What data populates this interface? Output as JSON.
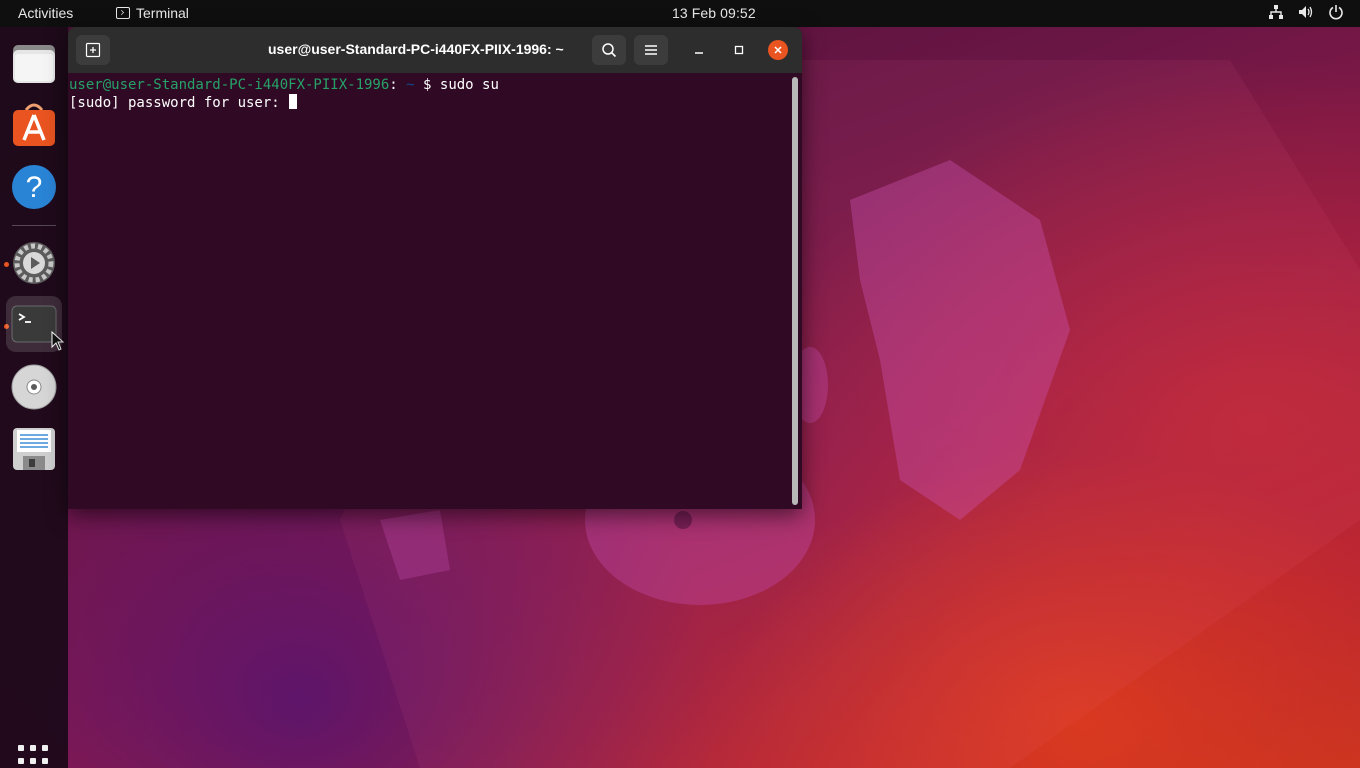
{
  "topbar": {
    "activities_label": "Activities",
    "app_menu_label": "Terminal",
    "clock": "13 Feb  09:52"
  },
  "dock": {
    "items": [
      {
        "name": "files",
        "label": "Files"
      },
      {
        "name": "software",
        "label": "Ubuntu Software"
      },
      {
        "name": "help",
        "label": "Help"
      },
      {
        "name": "settings",
        "label": "Settings"
      },
      {
        "name": "terminal",
        "label": "Terminal"
      },
      {
        "name": "disc",
        "label": "Disc"
      },
      {
        "name": "save",
        "label": "Text Editor"
      }
    ]
  },
  "terminal": {
    "title": "user@user-Standard-PC-i440FX-PIIX-1996: ~",
    "lines": {
      "l1_user": "user@user-Standard-PC-i440FX-PIIX-1996",
      "l1_sep": ":",
      "l1_path": " ~",
      "l1_cmd": "$ sudo su",
      "l2_text": "[sudo] password for user: "
    },
    "colors": {
      "background": "#300a24",
      "prompt_user": "#26a269",
      "prompt_path": "#12488b",
      "close_button": "#e95420"
    }
  },
  "icons": {
    "topbar": [
      "network-icon",
      "volume-icon",
      "power-icon"
    ],
    "titlebar": [
      "new-tab-icon",
      "search-icon",
      "menu-icon",
      "minimize-icon",
      "maximize-icon",
      "close-icon"
    ]
  }
}
